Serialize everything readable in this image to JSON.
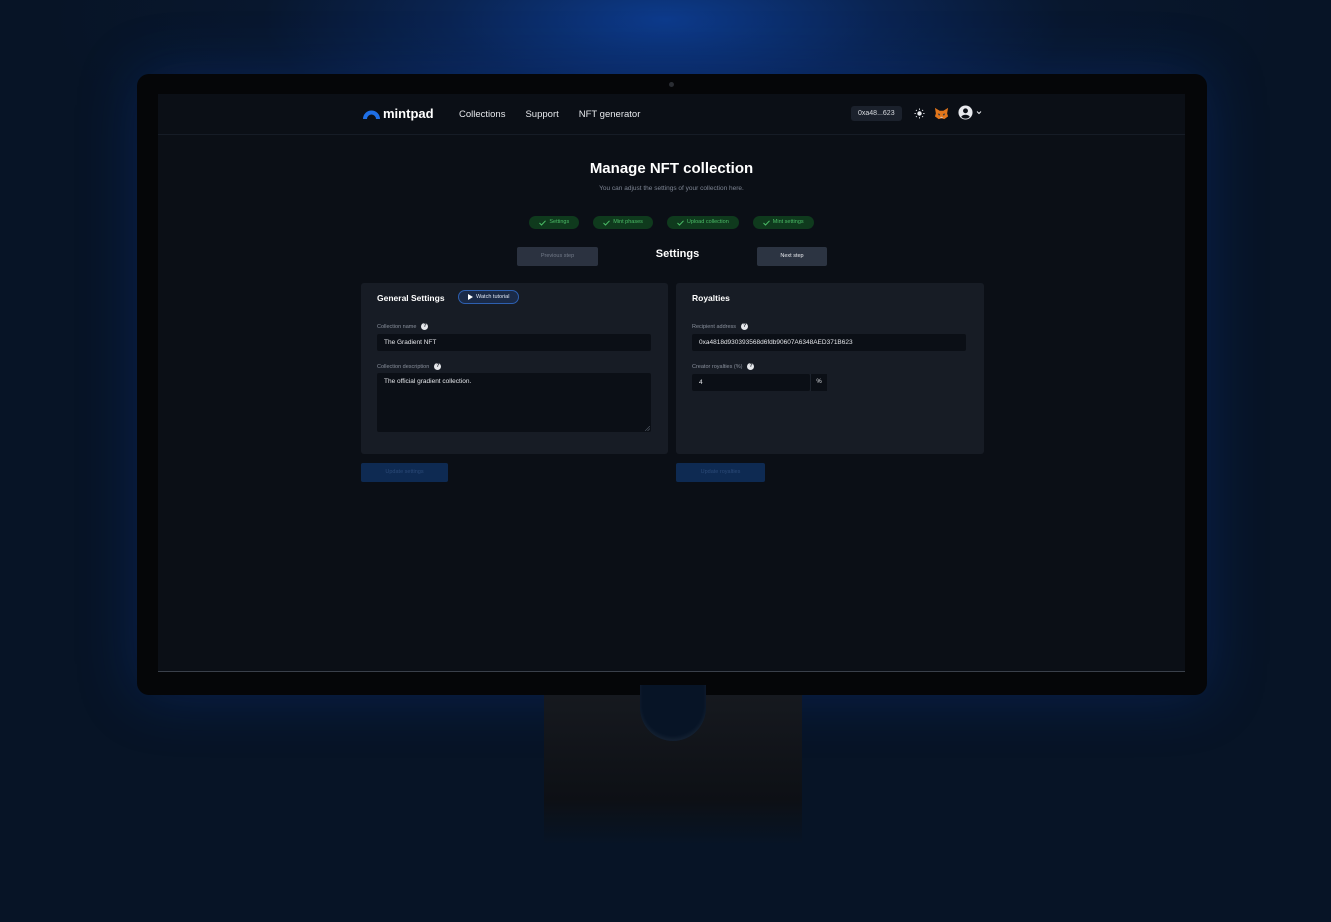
{
  "nav": {
    "logo_text": "mintpad",
    "links": [
      "Collections",
      "Support",
      "NFT generator"
    ],
    "wallet_address": "0xa48...623",
    "icons": [
      "sun-icon",
      "metamask-fox-icon",
      "user-avatar-icon",
      "chevron-down-icon"
    ]
  },
  "header": {
    "title": "Manage NFT collection",
    "subtitle": "You can adjust the settings of your collection here."
  },
  "steps": [
    {
      "label": "Settings",
      "status": "complete"
    },
    {
      "label": "Mint phases",
      "status": "complete"
    },
    {
      "label": "Upload collection",
      "status": "complete"
    },
    {
      "label": "Mint settings",
      "status": "complete"
    }
  ],
  "step_nav": {
    "previous_label": "Previous step",
    "current_title": "Settings",
    "next_label": "Next step"
  },
  "general_settings": {
    "heading": "General Settings",
    "tutorial_label": "Watch tutorial",
    "name_label": "Collection name",
    "name_value": "The Gradient NFT",
    "description_label": "Collection description",
    "description_value": "The official gradient collection.",
    "update_label": "Update settings"
  },
  "royalties": {
    "heading": "Royalties",
    "recipient_label": "Recipient address",
    "recipient_value": "0xa4818d930393568d6fdb90607A6348AED371B623",
    "royalty_label": "Creator royalties (%)",
    "royalty_value": "4",
    "royalty_suffix": "%",
    "update_label": "Update royalties"
  },
  "colors": {
    "accent": "#1f6fe5",
    "success": "#4bbd67",
    "background": "#0b0f16",
    "card": "#171c25"
  }
}
